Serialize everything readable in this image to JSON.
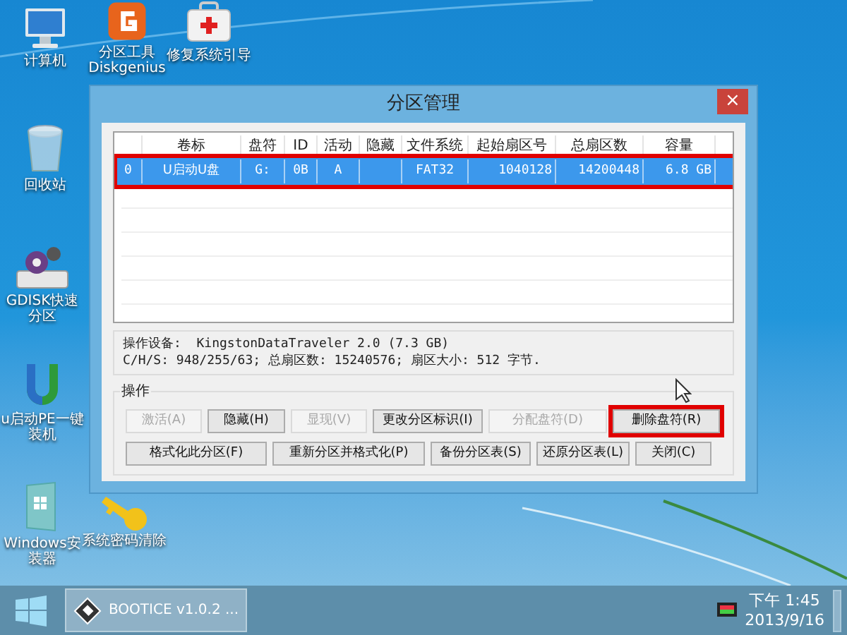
{
  "desktop_icons": [
    {
      "kind": "computer",
      "label": "计算机"
    },
    {
      "kind": "partition",
      "label": "分区工具\nDiskgenius"
    },
    {
      "kind": "repair",
      "label": "修复系统引导"
    },
    {
      "kind": "recycle",
      "label": "回收站"
    },
    {
      "kind": "gdisk",
      "label": "GDISK快速分区"
    },
    {
      "kind": "pe",
      "label": "u启动PE一键装机"
    },
    {
      "kind": "installer",
      "label": "Windows安装器"
    },
    {
      "kind": "key",
      "label": "系统密码清除"
    }
  ],
  "window": {
    "title": "分区管理",
    "close": "×"
  },
  "table": {
    "columns": [
      "",
      "卷标",
      "盘符",
      "ID",
      "活动",
      "隐藏",
      "文件系统",
      "起始扇区号",
      "总扇区数",
      "容量"
    ],
    "rows": [
      {
        "cells": [
          "0",
          "U启动U盘",
          "G:",
          "0B",
          "A",
          "",
          "FAT32",
          "1040128",
          "14200448",
          "6.8 GB"
        ],
        "selected": true,
        "highlighted": true
      }
    ]
  },
  "device_info": [
    "操作设备:  KingstonDataTraveler 2.0 (7.3 GB)",
    "C/H/S: 948/255/63; 总扇区数: 15240576; 扇区大小: 512 字节."
  ],
  "operations": {
    "title": "操作",
    "rows": [
      {
        "buttons": [
          {
            "label": "激活(A)",
            "disabled": true,
            "highlighted": false
          },
          {
            "label": "隐藏(H)",
            "disabled": false,
            "highlighted": false
          },
          {
            "label": "显现(V)",
            "disabled": true,
            "highlighted": false
          },
          {
            "label": "更改分区标识(I)",
            "disabled": false,
            "highlighted": false
          },
          {
            "label": "分配盘符(D)",
            "disabled": true,
            "highlighted": false
          },
          {
            "label": "删除盘符(R)",
            "disabled": false,
            "highlighted": true
          }
        ]
      },
      {
        "buttons": [
          {
            "label": "格式化此分区(F)",
            "disabled": false,
            "highlighted": false
          },
          {
            "label": "重新分区并格式化(P)",
            "disabled": false,
            "highlighted": false
          },
          {
            "label": "备份分区表(S)",
            "disabled": false,
            "highlighted": false
          },
          {
            "label": "还原分区表(L)",
            "disabled": false,
            "highlighted": false
          },
          {
            "label": "关闭(C)",
            "disabled": false,
            "highlighted": false
          }
        ]
      }
    ]
  },
  "taskbar": {
    "task": "BOOTICE v1.0.2 ...",
    "time": "下午 1:45",
    "date": "2013/9/16"
  }
}
